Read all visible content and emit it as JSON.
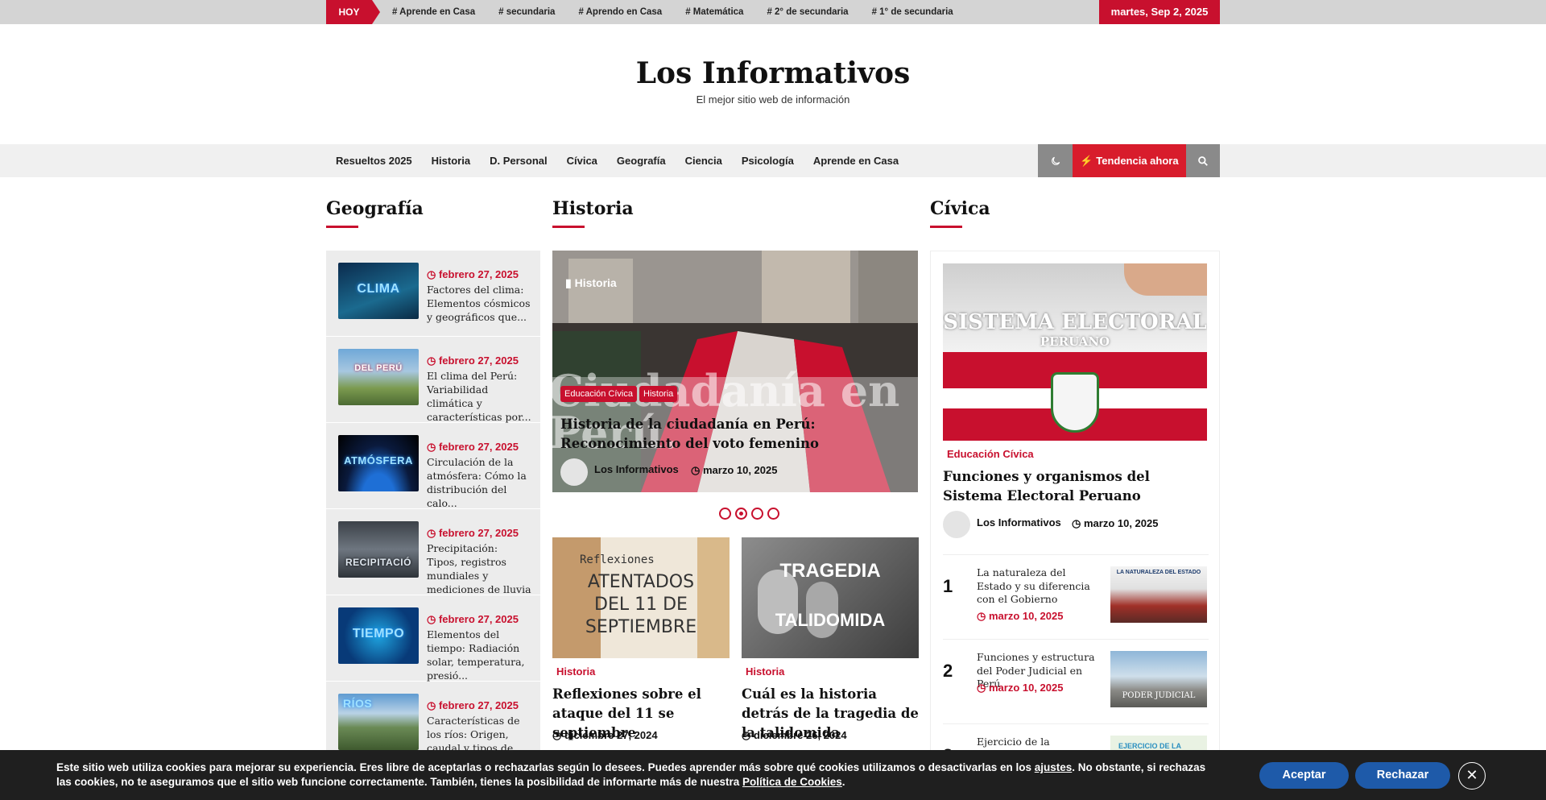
{
  "topbar": {
    "today_label": "HOY",
    "tags": [
      "# Aprende en Casa",
      "# secundaria",
      "# Aprendo en Casa",
      "# Matemática",
      "# 2° de secundaria",
      "# 1° de secundaria"
    ],
    "date": "martes, Sep 2, 2025"
  },
  "header": {
    "title": "Los Informativos",
    "tagline": "El mejor sitio web de información"
  },
  "nav": {
    "items": [
      "Resueltos 2025",
      "Historia",
      "D. Personal",
      "Cívica",
      "Geografía",
      "Ciencia",
      "Psicología",
      "Aprende en Casa"
    ],
    "dark_icon": "moon-icon",
    "trend_label": "Tendencia ahora",
    "trend_icon": "bolt-icon",
    "search_icon": "search-icon"
  },
  "geografia": {
    "heading": "Geografía",
    "items": [
      {
        "thumb_text": "CLIMA",
        "date": "febrero 27, 2025",
        "title": "Factores del clima: Elementos cósmicos y geográficos que..."
      },
      {
        "thumb_text": "DEL PERÚ",
        "date": "febrero 27, 2025",
        "title": "El clima del Perú: Variabilidad climática y características por..."
      },
      {
        "thumb_text": "ATMÓSFERA",
        "date": "febrero 27, 2025",
        "title": "Circulación de la atmósfera: Cómo la distribución del calo..."
      },
      {
        "thumb_text": "RECIPITACIÓ",
        "date": "febrero 27, 2025",
        "title": "Precipitación: Tipos, registros mundiales y mediciones de lluvia"
      },
      {
        "thumb_text": "TIEMPO",
        "date": "febrero 27, 2025",
        "title": "Elementos del tiempo: Radiación solar, temperatura, presió..."
      },
      {
        "thumb_text": "RÍOS",
        "date": "febrero 27, 2025",
        "title": "Características de los ríos: Origen, caudal y tipos de..."
      }
    ]
  },
  "historia": {
    "heading": "Historia",
    "slider": {
      "tag": "Historia",
      "ghost_text": "Ciudadanía en Perú.",
      "chips": [
        "Educación Cívica",
        "Historia"
      ],
      "title": "Historia de la ciudadanía en Perú: Reconocimiento del voto femenino",
      "author": "Los Informativos",
      "date": "marzo 10, 2025",
      "active_dot": 1
    },
    "cards": [
      {
        "img_text_1": "Reflexiones",
        "img_text_2": "ATENTADOS DEL 11 DE SEPTIEMBRE",
        "category": "Historia",
        "title": "Reflexiones sobre el ataque del 11 se septiembre",
        "date": "diciembre 27, 2024"
      },
      {
        "img_text_1": "TRAGEDIA",
        "img_text_2": "TALIDOMIDA",
        "category": "Historia",
        "title": "Cuál es la historia detrás de la tragedia de la talidomida",
        "date": "diciembre 26, 2024"
      }
    ]
  },
  "civica": {
    "heading": "Cívica",
    "featured": {
      "img_text_1": "SISTEMA ELECTORAL",
      "img_text_2": "PERUANO",
      "category": "Educación Cívica",
      "title": "Funciones y organismos del Sistema Electoral Peruano",
      "author": "Los Informativos",
      "date": "marzo 10, 2025"
    },
    "ranked": [
      {
        "num": "1",
        "title": "La naturaleza del Estado y su diferencia con el Gobierno",
        "date": "marzo 10, 2025",
        "img_text": "LA NATURALEZA DEL ESTADO"
      },
      {
        "num": "2",
        "title": "Funciones y estructura del Poder Judicial en Perú",
        "date": "marzo 10, 2025",
        "img_text": "PODER JUDICIAL"
      },
      {
        "num": "3",
        "title": "Ejercicio de la ciudadanía: Tipos y participación...",
        "date": "",
        "img_text": "EJERCICIO DE LA"
      }
    ]
  },
  "cookie": {
    "text_1": "Este sitio web utiliza cookies para mejorar su experiencia. Eres libre de aceptarlas o rechazarlas según lo desees. Puedes aprender más sobre qué cookies utilizamos o desactivarlas en los ",
    "link_settings": "ajustes",
    "text_2": ". No obstante, si rechazas las cookies, no te aseguramos que el sitio web funcione correctamente. También, tienes la posibilidad de informarte más de nuestra ",
    "link_policy": "Política de Cookies",
    "text_3": ".",
    "accept": "Aceptar",
    "reject": "Rechazar",
    "close_icon": "close-icon"
  }
}
